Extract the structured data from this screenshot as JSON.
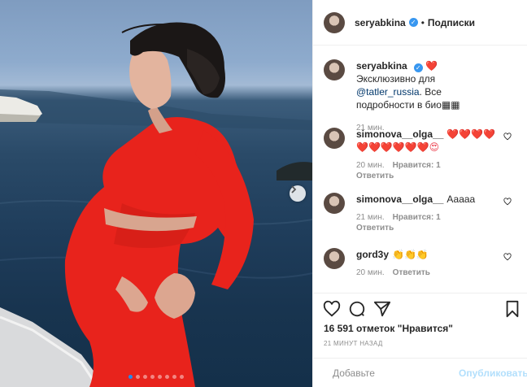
{
  "header": {
    "username": "seryabkina",
    "separator": "•",
    "follow_label": "Подписки"
  },
  "comments": [
    {
      "username": "seryabkina",
      "pre": "",
      "text_1": "Эксклюзивно для ",
      "mention": "@tatler_russia",
      "text_2": ". Все подробности в био",
      "text_emoji": "❤️",
      "suffix": "▦▦",
      "time": "21 мин.",
      "likes": "",
      "reply": ""
    },
    {
      "username": "simonova__olga__",
      "text": "❤️❤️❤️❤️❤️❤️❤️❤️❤️❤️😍",
      "time": "20 мин.",
      "likes": "Нравится: 1",
      "reply": "Ответить"
    },
    {
      "username": "simonova__olga__",
      "text": "Ааааа",
      "time": "21 мин.",
      "likes": "Нравится: 1",
      "reply": "Ответить"
    },
    {
      "username": "gord3y",
      "text": "👏👏👏",
      "time": "20 мин.",
      "likes": "",
      "reply": "Ответить"
    }
  ],
  "likes_line": {
    "count": "16 591 отметок",
    "label": "\"Нравится\""
  },
  "posted_ago": "21 минут назад",
  "comment_box": {
    "placeholder": "Добавьте",
    "publish_label": "Опубликовать"
  },
  "carousel": {
    "count": 8,
    "active_index": 0
  },
  "colors": {
    "link": "#00376b",
    "verified": "#3897f0",
    "publish_disabled": "#b2dffc",
    "active_dot": "#1e8cf2",
    "dress_red": "#e8231c"
  },
  "icons": {
    "like": "heart-icon",
    "comment": "comment-icon",
    "share": "share-icon",
    "save": "bookmark-icon",
    "emoji": "smiley-icon",
    "next": "chevron-right-icon"
  }
}
